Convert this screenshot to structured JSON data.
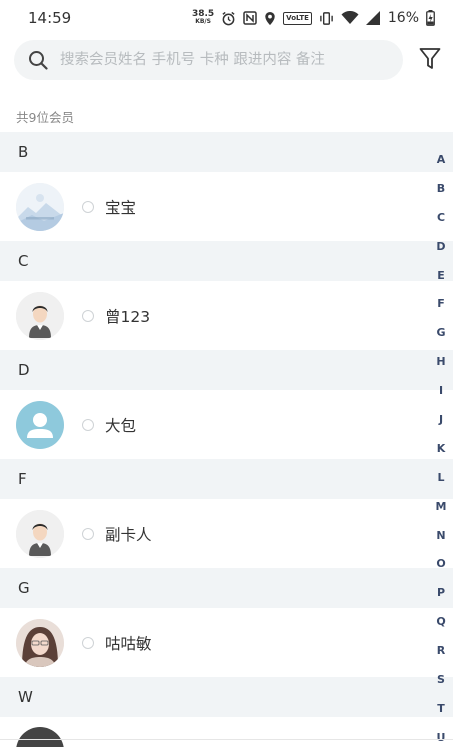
{
  "status_bar": {
    "time": "14:59",
    "net_speed_value": "38.5",
    "net_speed_unit": "KB/S",
    "volte": "VoLTE",
    "battery": "16%"
  },
  "search": {
    "placeholder": "搜索会员姓名 手机号 卡种 跟进内容 备注"
  },
  "member_count": "共9位会员",
  "sections": [
    {
      "letter": "B",
      "members": [
        {
          "name": "宝宝",
          "avatar": "landscape-placeholder"
        }
      ]
    },
    {
      "letter": "C",
      "members": [
        {
          "name": "曾123",
          "avatar": "default-person"
        }
      ]
    },
    {
      "letter": "D",
      "members": [
        {
          "name": "大包",
          "avatar": "blue-person"
        }
      ]
    },
    {
      "letter": "F",
      "members": [
        {
          "name": "副卡人",
          "avatar": "default-person"
        }
      ]
    },
    {
      "letter": "G",
      "members": [
        {
          "name": "咕咕敏",
          "avatar": "photo"
        }
      ]
    },
    {
      "letter": "W",
      "members": []
    }
  ],
  "index_letters": [
    "A",
    "B",
    "C",
    "D",
    "E",
    "F",
    "G",
    "H",
    "I",
    "J",
    "K",
    "L",
    "M",
    "N",
    "O",
    "P",
    "Q",
    "R",
    "S",
    "T",
    "U"
  ],
  "colors": {
    "section_bg": "#f1f4f6",
    "search_bg": "#f2f4f5",
    "index_text": "#3a4a6b"
  }
}
